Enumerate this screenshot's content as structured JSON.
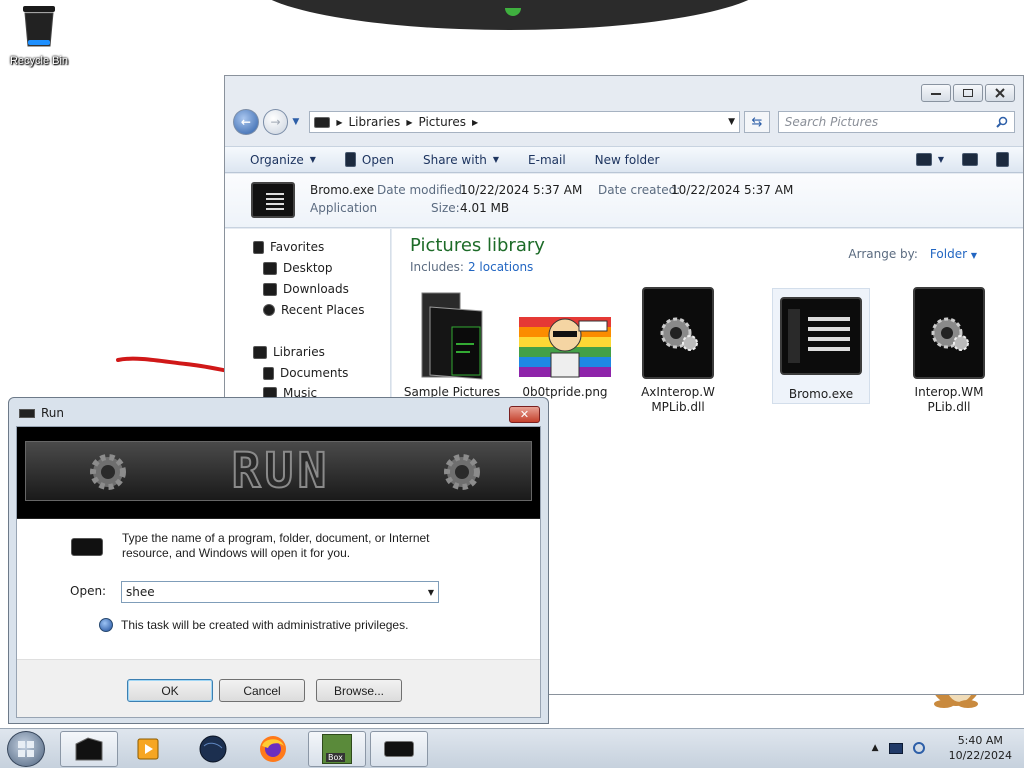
{
  "desktop": {
    "recycle_bin_label": "Recycle Bin"
  },
  "explorer": {
    "breadcrumb": [
      "Libraries",
      "Pictures"
    ],
    "search_placeholder": "Search Pictures",
    "toolbar": {
      "organize": "Organize",
      "open": "Open",
      "share_with": "Share with",
      "email": "E-mail",
      "new_folder": "New folder"
    },
    "details": {
      "name": "Bromo.exe",
      "type": "Application",
      "date_modified_label": "Date modified:",
      "date_modified": "10/22/2024 5:37 AM",
      "size_label": "Size:",
      "size": "4.01 MB",
      "date_created_label": "Date created:",
      "date_created": "10/22/2024 5:37 AM"
    },
    "sidebar": {
      "favorites": "Favorites",
      "desktop": "Desktop",
      "downloads": "Downloads",
      "recent_places": "Recent Places",
      "libraries": "Libraries",
      "documents": "Documents",
      "music": "Music"
    },
    "library": {
      "title": "Pictures library",
      "includes_label": "Includes:",
      "includes_link": "2 locations",
      "arrange_label": "Arrange by:",
      "arrange_value": "Folder"
    },
    "files": [
      {
        "name": "Sample Pictures"
      },
      {
        "name": "0b0tpride.png"
      },
      {
        "name": "AxInterop.WMPLib.dll"
      },
      {
        "name": "Bromo.exe"
      },
      {
        "name": "Interop.WMPLib.dll"
      }
    ]
  },
  "run_dialog": {
    "title": "Run",
    "banner_text": "RUN",
    "description": "Type the name of a program, folder, document, or Internet resource, and Windows will open it for you.",
    "open_label": "Open:",
    "open_value": "shee",
    "admin_note": "This task will be created with administrative privileges.",
    "ok": "OK",
    "cancel": "Cancel",
    "browse": "Browse..."
  },
  "taskbar": {
    "time": "5:40 AM",
    "date": "10/22/2024",
    "bromo_badge": "Box"
  },
  "colors": {
    "library_title": "#1d6b28",
    "link": "#2266c2",
    "close_button": "#c4402c"
  }
}
